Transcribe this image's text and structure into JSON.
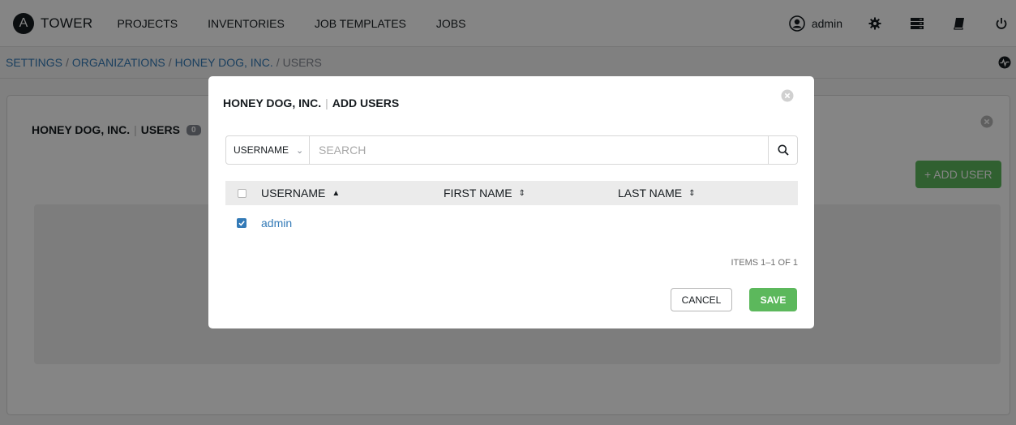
{
  "app": {
    "name": "TOWER",
    "logo_letter": "A"
  },
  "nav": {
    "items": [
      "PROJECTS",
      "INVENTORIES",
      "JOB TEMPLATES",
      "JOBS"
    ],
    "user": "admin",
    "icons": [
      "user-circle-icon",
      "gear-icon",
      "server-icon",
      "book-icon",
      "power-icon"
    ]
  },
  "breadcrumb": {
    "items": [
      "SETTINGS",
      "ORGANIZATIONS",
      "HONEY DOG, INC."
    ],
    "current": "USERS",
    "separator": "/"
  },
  "panel": {
    "org_name": "HONEY DOG, INC.",
    "section": "USERS",
    "count": "0",
    "add_user_label": "+ ADD USER"
  },
  "modal": {
    "org_name": "HONEY DOG, INC.",
    "title": "ADD USERS",
    "search": {
      "field": "USERNAME",
      "placeholder": "SEARCH"
    },
    "columns": {
      "username": "USERNAME",
      "first_name": "FIRST NAME",
      "last_name": "LAST NAME"
    },
    "rows": [
      {
        "username": "admin",
        "first_name": "",
        "last_name": "",
        "checked": true
      }
    ],
    "items_count": "ITEMS 1–1 OF 1",
    "cancel_label": "CANCEL",
    "save_label": "SAVE"
  },
  "colors": {
    "accent_green": "#5cb85c",
    "link_blue": "#337ab7",
    "badge_gray": "#848992"
  }
}
